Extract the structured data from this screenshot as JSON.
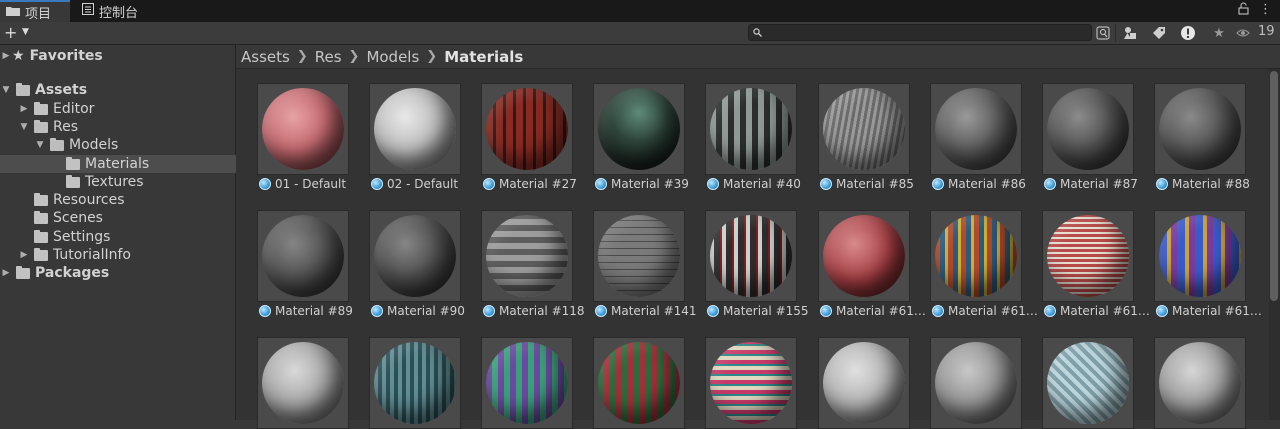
{
  "tabs": [
    {
      "label": "项目",
      "icon": "folder-icon"
    },
    {
      "label": "控制台",
      "icon": "console-icon"
    }
  ],
  "window_controls": {
    "lock": "🔓",
    "menu": "⋮"
  },
  "toolbar": {
    "add_label": "+",
    "search_placeholder": "",
    "hidden_count": "19"
  },
  "sidebar": {
    "items": [
      {
        "label": "Favorites"
      },
      {
        "label": "Assets"
      },
      {
        "label": "Editor"
      },
      {
        "label": "Res"
      },
      {
        "label": "Models"
      },
      {
        "label": "Materials"
      },
      {
        "label": "Textures"
      },
      {
        "label": "Resources"
      },
      {
        "label": "Scenes"
      },
      {
        "label": "Settings"
      },
      {
        "label": "TutorialInfo"
      },
      {
        "label": "Packages"
      }
    ]
  },
  "breadcrumb": [
    "Assets",
    "Res",
    "Models",
    "Materials"
  ],
  "materials": [
    {
      "name": "01 - Default"
    },
    {
      "name": "02 - Default"
    },
    {
      "name": "Material #27"
    },
    {
      "name": "Material #39"
    },
    {
      "name": "Material #40"
    },
    {
      "name": "Material #85"
    },
    {
      "name": "Material #86"
    },
    {
      "name": "Material #87"
    },
    {
      "name": "Material #88"
    },
    {
      "name": "Material #89"
    },
    {
      "name": "Material #90"
    },
    {
      "name": "Material #118"
    },
    {
      "name": "Material #141"
    },
    {
      "name": "Material #155"
    },
    {
      "name": "Material #61…"
    },
    {
      "name": "Material #61…"
    },
    {
      "name": "Material #61…"
    },
    {
      "name": "Material #61…"
    }
  ],
  "colors": {
    "accent": "#3a79bb",
    "material_icon": "#3d9ad6"
  }
}
